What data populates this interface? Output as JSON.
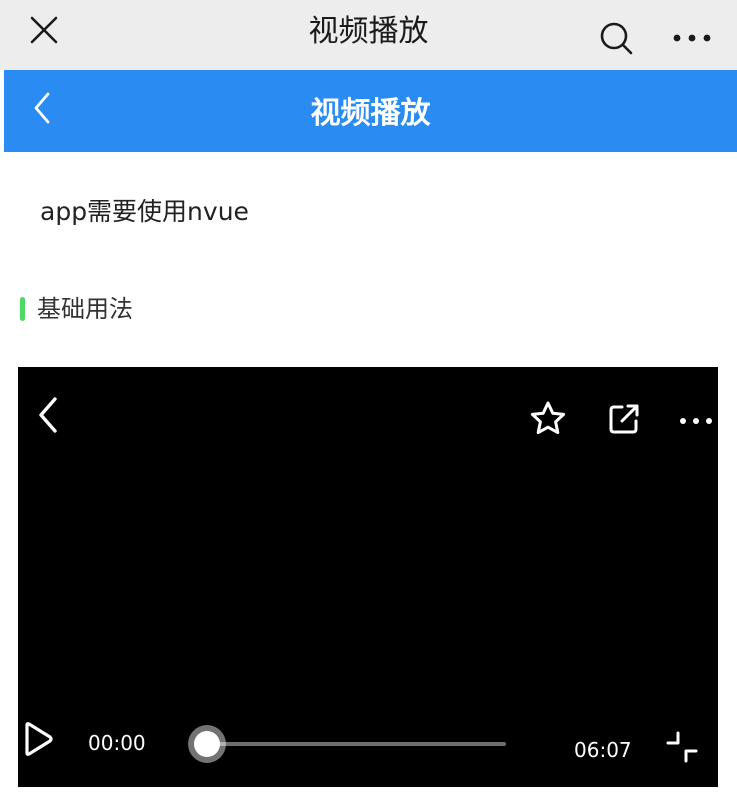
{
  "wechat_bar": {
    "title": "视频播放",
    "close_icon": "close-icon",
    "search_icon": "search-icon",
    "more_icon": "more-dots-icon"
  },
  "navbar": {
    "title": "视频播放",
    "back_icon": "chevron-left-icon",
    "color": "#2a8cf2"
  },
  "content": {
    "note": "app需要使用nvue",
    "section_title": "基础用法",
    "section_accent": "#4cd964"
  },
  "video": {
    "current_time": "00:00",
    "total_time": "06:07",
    "progress": 0,
    "icons": [
      "chevron-left-icon",
      "star-icon",
      "share-icon",
      "more-dots-icon",
      "play-icon",
      "exit-fullscreen-icon"
    ]
  }
}
